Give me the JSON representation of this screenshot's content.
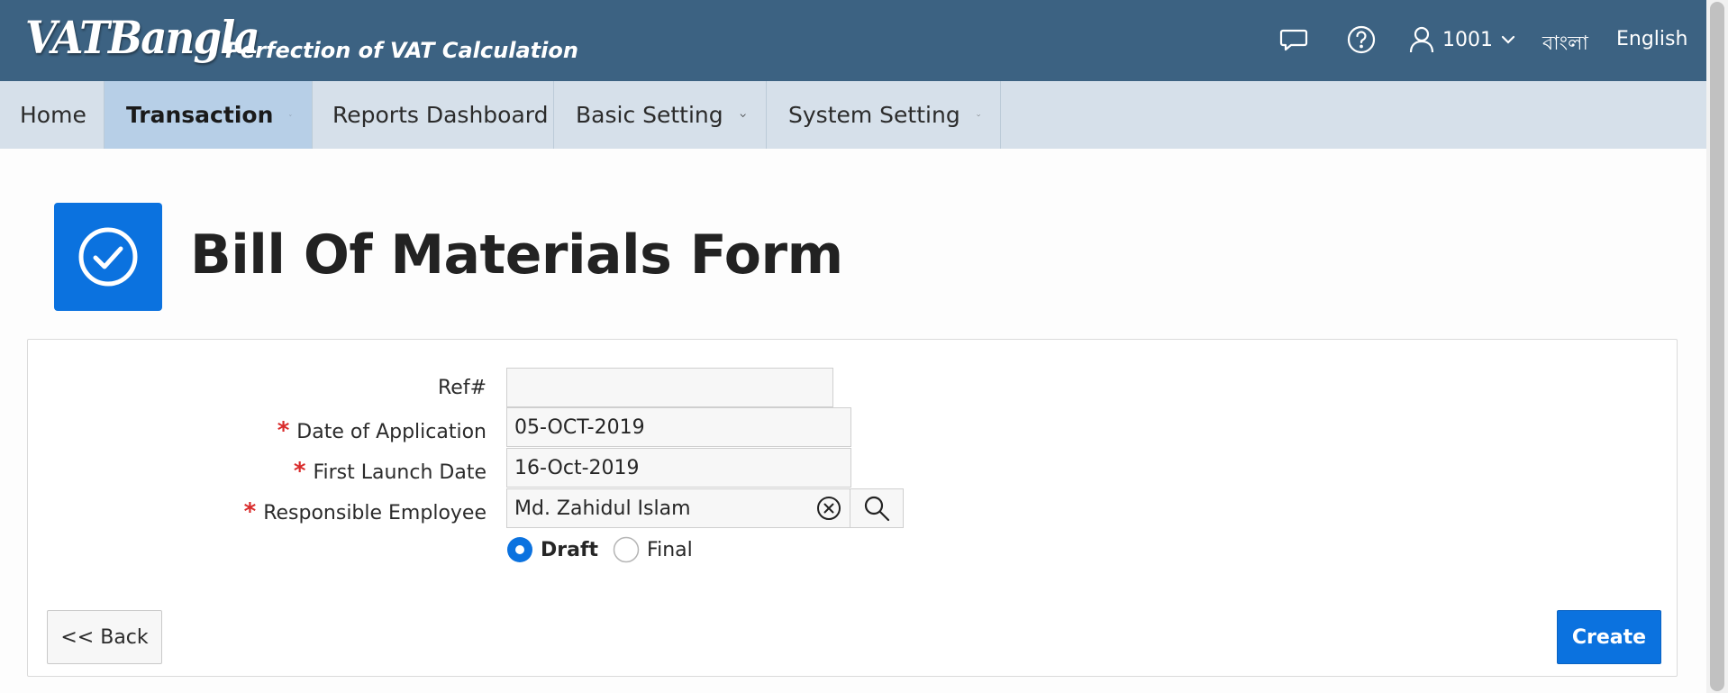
{
  "header": {
    "logo_text": "VATBangla",
    "tagline": "Perfection of VAT Calculation",
    "user_id": "1001",
    "lang_bangla": "বাংলা",
    "lang_english": "English",
    "icons": [
      "chat-icon",
      "help-icon",
      "user-icon",
      "chevron-down-icon"
    ]
  },
  "nav": {
    "items": [
      {
        "label": "Home"
      },
      {
        "label": "Transaction"
      },
      {
        "label": "Reports Dashboard"
      },
      {
        "label": "Basic Setting"
      },
      {
        "label": "System Setting"
      }
    ],
    "active": "Transaction"
  },
  "page": {
    "title": "Bill Of Materials Form",
    "icon": "check-circle-icon"
  },
  "form": {
    "ref": {
      "label": "Ref#",
      "value": ""
    },
    "date_application": {
      "label": "Date of Application",
      "value": "05-OCT-2019",
      "required": true
    },
    "first_launch": {
      "label": "First Launch Date",
      "value": "16-Oct-2019",
      "required": true
    },
    "employee": {
      "label": "Responsible Employee",
      "value": "Md. Zahidul Islam",
      "required": true
    },
    "required_marker": "*",
    "status": {
      "options": [
        {
          "label": "Draft",
          "selected": true
        },
        {
          "label": "Final",
          "selected": false
        }
      ]
    }
  },
  "buttons": {
    "back": "<< Back",
    "create": "Create"
  },
  "colors": {
    "header_bg": "#3c6282",
    "nav_bg": "#d6e0ea",
    "nav_active_bg": "#b7cfe7",
    "accent": "#0b72df",
    "required": "#d92b2b"
  }
}
